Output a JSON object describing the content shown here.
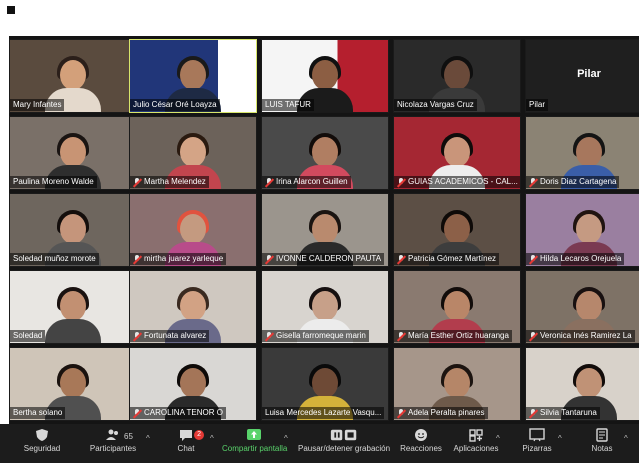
{
  "participants": [
    {
      "name": "Mary Infantes",
      "muted": false
    },
    {
      "name": "Julio César Oré Loayza",
      "muted": false,
      "active": true
    },
    {
      "name": "LUIS TAFUR",
      "muted": false
    },
    {
      "name": "Nicolaza Vargas Cruz",
      "muted": false
    },
    {
      "name": "Pilar",
      "muted": false,
      "video_off": true
    },
    {
      "name": "Paulina Moreno Walde",
      "muted": false
    },
    {
      "name": "Martha Melendez",
      "muted": true
    },
    {
      "name": "Irina Alarcon Guillen",
      "muted": true
    },
    {
      "name": "GUIAS ACADEMICOS - CAL...",
      "muted": true
    },
    {
      "name": "Doris Diaz Cartagena",
      "muted": true
    },
    {
      "name": "Soledad muñoz morote",
      "muted": false
    },
    {
      "name": "mirtha juarez yarleque",
      "muted": true
    },
    {
      "name": "IVONNE CALDERON PAUTA",
      "muted": true
    },
    {
      "name": "Patricia Gómez Martínez",
      "muted": true
    },
    {
      "name": "Hilda Lecaros Orejuela",
      "muted": true
    },
    {
      "name": "Soledad",
      "muted": false
    },
    {
      "name": "Fortunata alvarez",
      "muted": true
    },
    {
      "name": "Gisella farromeque marin",
      "muted": true
    },
    {
      "name": "María Esther Ortiz huaranga",
      "muted": true
    },
    {
      "name": "Veronica Inés Ramirez La",
      "muted": true
    },
    {
      "name": "Bertha solano",
      "muted": false
    },
    {
      "name": "CAROLINA TENOR O",
      "muted": true
    },
    {
      "name": "Luisa Mercedes Lazarte Vasqu...",
      "muted": false
    },
    {
      "name": "Adela Peralta pinares",
      "muted": true
    },
    {
      "name": "Silvia Tantaruna",
      "muted": true
    }
  ],
  "video_off_label": "Pilar",
  "toolbar": {
    "security": "Seguridad",
    "participants": "Participantes",
    "participants_count": "65",
    "chat": "Chat",
    "chat_badge": "2",
    "share": "Compartir pantalla",
    "record": "Pausar/detener grabación",
    "reactions": "Reacciones",
    "apps": "Aplicaciones",
    "whiteboards": "Pizarras",
    "notes": "Notas"
  },
  "colors": {
    "toolbar_bg": "#1c1c1c",
    "grid_bg": "#141414",
    "active_outline": "#d8e66b",
    "share_green": "#59d36b",
    "mute_red": "#e53935",
    "slide_red": "#b51f2e"
  }
}
